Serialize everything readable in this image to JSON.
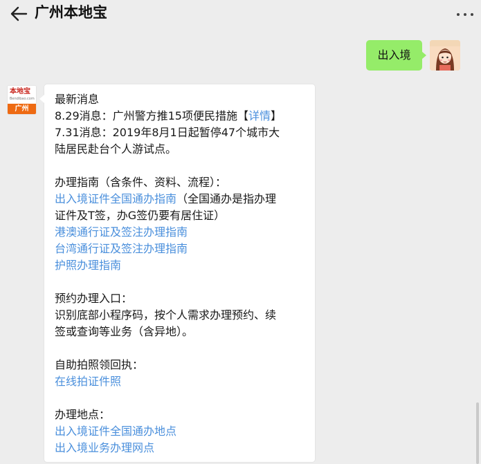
{
  "header": {
    "title": "广州本地宝"
  },
  "outgoing": {
    "text": "出入境"
  },
  "incoming": {
    "avatar": {
      "logo": "本地宝",
      "sub": "Bendibao.com",
      "city": "广州"
    },
    "latest_heading": "最新消息",
    "news1_prefix": "8.29消息：广州警方推15项便民措施【",
    "news1_link": "详情",
    "news1_suffix": "】",
    "news2_line1": "7.31消息：2019年8月1日起暂停47个城市大",
    "news2_line2": "陆居民赴台个人游试点。",
    "guide_heading": "办理指南（含条件、资料、流程）：",
    "guide_link1": "出入境证件全国通办指南",
    "guide_note_part1": "（全国通办是指办理",
    "guide_note_line2": "证件及T签，办G签仍要有居住证）",
    "guide_link2": "港澳通行证及签注办理指南",
    "guide_link3": "台湾通行证及签注办理指南",
    "guide_link4": "护照办理指南",
    "booking_heading": "预约办理入口：",
    "booking_line1": "识别底部小程序码，按个人需求办理预约、续",
    "booking_line2": "签或查询等业务（含异地）。",
    "photo_heading": "自助拍照领回执：",
    "photo_link": "在线拍证件照",
    "location_heading": "办理地点：",
    "location_link1": "出入境证件全国通办地点",
    "location_link2": "出入境业务办理网点"
  },
  "colors": {
    "background": "#ededed",
    "outgoing_bubble": "#95ec69",
    "incoming_bubble": "#ffffff",
    "link": "#4a8fdc",
    "avatar_orange": "#ee6a12"
  },
  "icons": [
    "back-arrow-icon",
    "more-dots-icon"
  ]
}
